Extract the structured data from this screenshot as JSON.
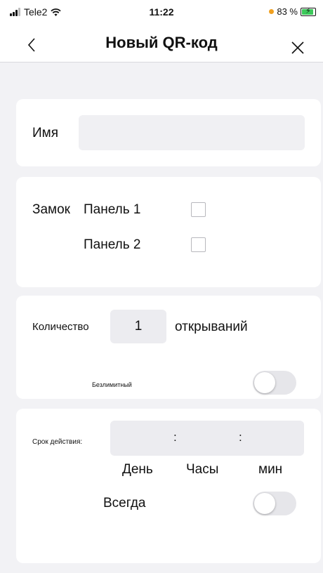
{
  "status_bar": {
    "carrier": "Tele2",
    "time": "11:22",
    "battery_percent": "83 %"
  },
  "nav": {
    "back_icon": "chevron-left-icon",
    "title": "Новый QR-код",
    "close_icon": "close-icon"
  },
  "name_section": {
    "label": "Имя",
    "value": ""
  },
  "lock_section": {
    "label": "Замок",
    "panels": [
      {
        "label": "Панель 1",
        "checked": false
      },
      {
        "label": "Панель 2",
        "checked": false
      }
    ]
  },
  "count_section": {
    "label": "Количество",
    "value": "1",
    "unit": "открываний",
    "unlimited_label": "Безлимитный",
    "unlimited_on": false
  },
  "validity_section": {
    "label": "Срок действия:",
    "separator": ":",
    "day_label": "День",
    "hours_label": "Часы",
    "min_label": "мин",
    "always_label": "Всегда",
    "always_on": false
  }
}
